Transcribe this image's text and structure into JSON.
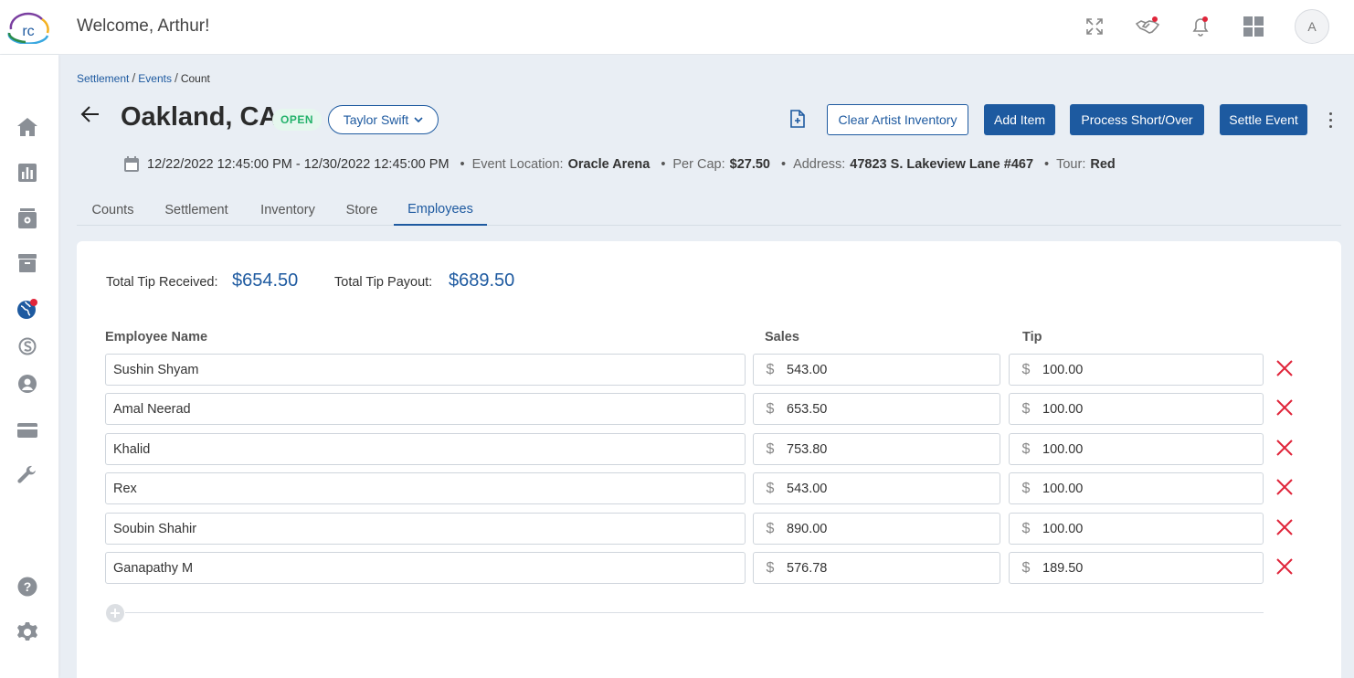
{
  "header": {
    "welcome": "Welcome, Arthur!",
    "logo_text": "rc",
    "avatar_initial": "A",
    "icons": [
      "expand-icon",
      "handshake-icon",
      "bell-icon",
      "apps-grid-icon"
    ]
  },
  "sidebar": {
    "items": [
      "home-icon",
      "reports-icon",
      "stand-icon",
      "archive-icon",
      "globe-icon",
      "settlement-s-icon",
      "support-icon",
      "card-icon",
      "wrench-icon",
      "help-icon",
      "settings-icon"
    ]
  },
  "breadcrumb": {
    "items": [
      "Settlement",
      "Events",
      "Count"
    ]
  },
  "event": {
    "title": "Oakland, CA",
    "status": "OPEN",
    "artist": "Taylor Swift",
    "date_range": "12/22/2022 12:45:00 PM - 12/30/2022 12:45:00 PM",
    "location_label": "Event Location:",
    "location": "Oracle Arena",
    "percap_label": "Per Cap:",
    "percap": "$27.50",
    "address_label": "Address:",
    "address": "47823 S. Lakeview Lane #467",
    "tour_label": "Tour:",
    "tour": "Red"
  },
  "actions": {
    "clear_inventory": "Clear Artist Inventory",
    "add_item": "Add Item",
    "process": "Process Short/Over",
    "settle": "Settle Event"
  },
  "tabs": [
    "Counts",
    "Settlement",
    "Inventory",
    "Store",
    "Employees"
  ],
  "active_tab": "Employees",
  "totals": {
    "received_label": "Total Tip Received:",
    "received": "$654.50",
    "payout_label": "Total Tip Payout:",
    "payout": "$689.50"
  },
  "table": {
    "headers": [
      "Employee Name",
      "Sales",
      "Tip"
    ],
    "currency": "$",
    "rows": [
      {
        "name": "Sushin Shyam",
        "sales": "543.00",
        "tip": "100.00"
      },
      {
        "name": "Amal Neerad",
        "sales": "653.50",
        "tip": "100.00"
      },
      {
        "name": "Khalid",
        "sales": "753.80",
        "tip": "100.00"
      },
      {
        "name": "Rex",
        "sales": "543.00",
        "tip": "100.00"
      },
      {
        "name": "Soubin Shahir",
        "sales": "890.00",
        "tip": "100.00"
      },
      {
        "name": "Ganapathy M",
        "sales": "576.78",
        "tip": "189.50"
      }
    ]
  },
  "colors": {
    "primary": "#1d5aa0",
    "open_badge": "#24b26b",
    "delete": "#e0253a",
    "background": "#e9eef4"
  }
}
